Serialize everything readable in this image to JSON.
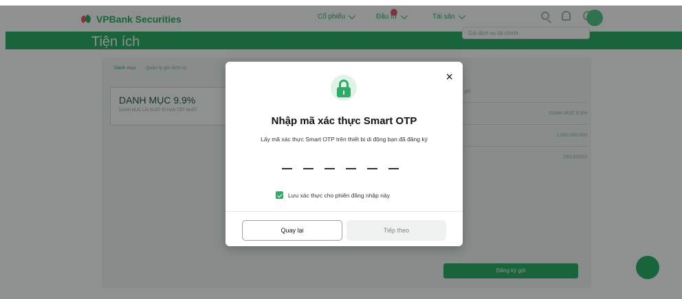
{
  "header": {
    "brand": "VPBank Securities",
    "nav": [
      "Cổ phiếu",
      "Đầu tư",
      "Tài sản"
    ]
  },
  "page": {
    "title": "Tiện ích",
    "select_placeholder": "Gói dịch vụ tài chính",
    "tabs": [
      "Danh mục",
      "Quản lý gói dịch vụ"
    ],
    "portfolio_title": "DANH MỤC 9.9%",
    "portfolio_subtitle": "DANH MỤC LÃI SUẤT KÌ HẠN TỐT NHẤT",
    "panel_heading": "Thông tin gói",
    "panel_value": "DANH MỤC 9.9%",
    "panel_amount": "1.000.000.000",
    "panel_date": "29/12/2023",
    "action_label": "Đăng ký gói"
  },
  "modal": {
    "title": "Nhập mã xác thực Smart OTP",
    "subtitle": "Lấy mã xác thực Smart OTP trên thiết bị di động bạn đã đăng ký",
    "remember_label": "Lưu xác thực cho phiên đăng nhập này",
    "back_label": "Quay lại",
    "next_label": "Tiếp theo",
    "otp_slots": 6,
    "remember_checked": true
  },
  "colors": {
    "accent": "#2CAD63",
    "banner": "#1EA95C",
    "overlay": "#131917"
  },
  "icons": {
    "brand": "vpbank-logo-icon",
    "search": "search-icon",
    "notifications": "bell-icon",
    "support": "headset-icon",
    "lock": "lock-icon",
    "close": "close-icon"
  }
}
